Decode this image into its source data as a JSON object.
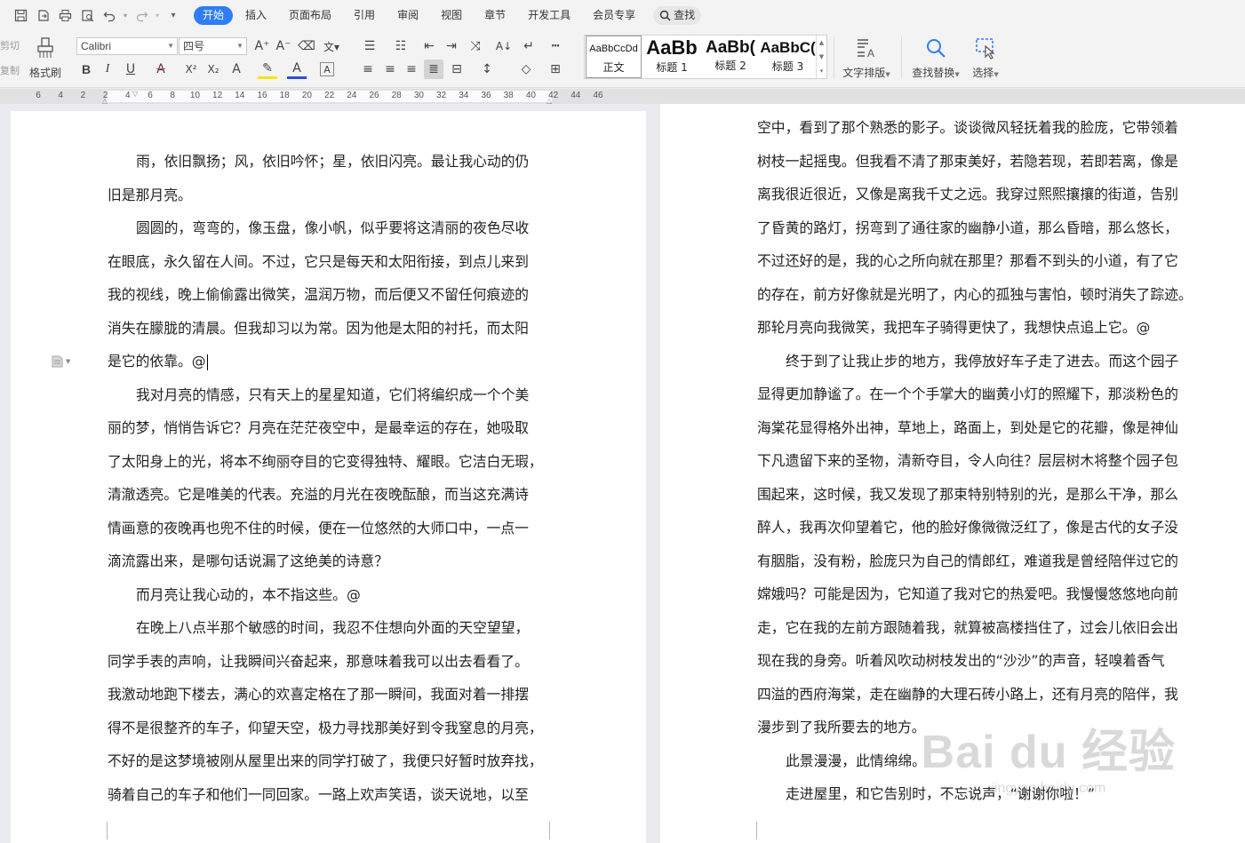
{
  "tabs": [
    {
      "label": "开始",
      "active": true
    },
    {
      "label": "插入"
    },
    {
      "label": "页面布局"
    },
    {
      "label": "引用"
    },
    {
      "label": "审阅"
    },
    {
      "label": "视图"
    },
    {
      "label": "章节"
    },
    {
      "label": "开发工具"
    },
    {
      "label": "会员专享"
    }
  ],
  "search_tab": "查找",
  "ribbon": {
    "cut": "剪切",
    "copy": "复制",
    "format_painter": "格式刷",
    "font_name": "Calibri",
    "font_size": "四号",
    "styles": [
      {
        "sample": "AaBbCcDd",
        "name": "正文"
      },
      {
        "sample": "AaBb",
        "name": "标题 1"
      },
      {
        "sample": "AaBb(",
        "name": "标题 2"
      },
      {
        "sample": "AaBbC(",
        "name": "标题 3"
      }
    ],
    "text_layout": "文字排版",
    "find_replace": "查找替换",
    "select": "选择"
  },
  "ruler_ticks": [
    "6",
    "4",
    "2",
    "2",
    "4",
    "6",
    "8",
    "10",
    "12",
    "14",
    "16",
    "18",
    "20",
    "22",
    "24",
    "26",
    "28",
    "30",
    "32",
    "34",
    "36",
    "38",
    "40",
    "42",
    "44",
    "46"
  ],
  "left_page": [
    {
      "text": "雨，依旧飘扬；风，依旧吟怀；星，依旧闪亮。最让我心动的仍",
      "indent": true
    },
    {
      "text": "旧是那月亮。"
    },
    {
      "text": "圆圆的，弯弯的，像玉盘，像小帆，似乎要将这清丽的夜色尽收",
      "indent": true
    },
    {
      "text": "在眼底，永久留在人间。不过，它只是每天和太阳衔接，到点儿来到"
    },
    {
      "text": "我的视线，晚上偷偷露出微笑，温润万物，而后便又不留任何痕迹的"
    },
    {
      "text": "消失在朦胧的清晨。但我却习以为常。因为他是太阳的衬托，而太阳"
    },
    {
      "text": "是它的依靠。@",
      "cursor": true
    },
    {
      "text": "我对月亮的情感，只有天上的星星知道，它们将编织成一个个美",
      "indent": true
    },
    {
      "text": "丽的梦，悄悄告诉它？月亮在茫茫夜空中，是最幸运的存在，她吸取"
    },
    {
      "text": "了太阳身上的光，将本不绚丽夺目的它变得独特、耀眼。它洁白无瑕，"
    },
    {
      "text": "清澈透亮。它是唯美的代表。充溢的月光在夜晚酝酿，而当这充满诗"
    },
    {
      "text": "情画意的夜晚再也兜不住的时候，便在一位悠然的大师口中，一点一"
    },
    {
      "text": "滴流露出来，是哪句话说漏了这绝美的诗意？"
    },
    {
      "text": "而月亮让我心动的，本不指这些。@",
      "indent": true
    },
    {
      "text": "在晚上八点半那个敏感的时间，我忍不住想向外面的天空望望，",
      "indent": true
    },
    {
      "text": "同学手表的声响，让我瞬间兴奋起来，那意味着我可以出去看看了。"
    },
    {
      "text": "我激动地跑下楼去，满心的欢喜定格在了那一瞬间，我面对着一排摆"
    },
    {
      "text": "得不是很整齐的车子，仰望天空，极力寻找那美好到令我窒息的月亮，"
    },
    {
      "text": "不好的是这梦境被刚从屋里出来的同学打破了，我便只好暂时放弃找，"
    },
    {
      "text": "骑着自己的车子和他们一同回家。一路上欢声笑语，谈天说地，以至"
    }
  ],
  "right_page": [
    {
      "text": "空中，看到了那个熟悉的影子。谈谈微风轻抚着我的脸庞，它带领着"
    },
    {
      "text": "树枝一起摇曳。但我看不清了那束美好，若隐若现，若即若离，像是"
    },
    {
      "text": "离我很近很近，又像是离我千丈之远。我穿过熙熙攘攘的街道，告别"
    },
    {
      "text": "了昏黄的路灯，拐弯到了通往家的幽静小道，那么昏暗，那么悠长，"
    },
    {
      "text": "不过还好的是，我的心之所向就在那里？那看不到头的小道，有了它"
    },
    {
      "text": "的存在，前方好像就是光明了，内心的孤独与害怕，顿时消失了踪迹。"
    },
    {
      "text": "那轮月亮向我微笑，我把车子骑得更快了，我想快点追上它。@"
    },
    {
      "text": "终于到了让我止步的地方，我停放好车子走了进去。而这个园子",
      "indent": true
    },
    {
      "text": "显得更加静谧了。在一个个手掌大的幽黄小灯的照耀下，那淡粉色的"
    },
    {
      "text": "海棠花显得格外出神，草地上，路面上，到处是它的花瓣，像是神仙"
    },
    {
      "text": "下凡遗留下来的圣物，清新夺目，令人向往？层层树木将整个园子包"
    },
    {
      "text": "围起来，这时候，我又发现了那束特别特别的光，是那么干净，那么"
    },
    {
      "text": "醉人，我再次仰望着它，他的脸好像微微泛红了，像是古代的女子没"
    },
    {
      "text": "有胭脂，没有粉，脸庞只为自己的情郎红，难道我是曾经陪伴过它的"
    },
    {
      "text": "嫦娥吗？可能是因为，它知道了我对它的热爱吧。我慢慢悠悠地向前"
    },
    {
      "text": "走，它在我的左前方跟随着我，就算被高楼挡住了，过会儿依旧会出"
    },
    {
      "text": "现在我的身旁。听着风吹动树枝发出的“沙沙”的声音，轻嗅着香气"
    },
    {
      "text": "四溢的西府海棠，走在幽静的大理石砖小路上，还有月亮的陪伴，我"
    },
    {
      "text": "漫步到了我所要去的地方。"
    },
    {
      "text": "此景漫漫，此情绵绵。",
      "indent": true
    },
    {
      "text": "走进屋里，和它告别时，不忘说声，“谢谢你啦！”",
      "indent": true
    }
  ],
  "watermark": {
    "main": "Bai du 经验",
    "sub": "jingyan.baidu.com"
  }
}
